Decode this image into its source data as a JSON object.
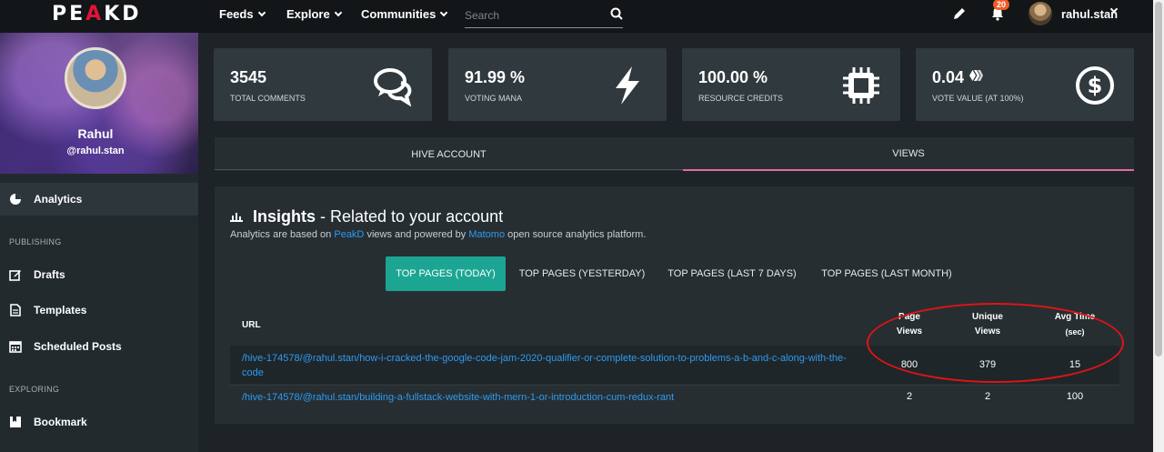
{
  "brand": {
    "logo_text_left": "PE",
    "logo_text_mid": "A",
    "logo_text_right": "KD"
  },
  "nav": {
    "feeds": "Feeds",
    "explore": "Explore",
    "communities": "Communities",
    "search_placeholder": "Search",
    "notifications_count": "20",
    "username": "rahul.stan"
  },
  "profile": {
    "name": "Rahul",
    "handle": "@rahul.stan"
  },
  "sidebar": {
    "analytics": "Analytics",
    "section_publishing": "PUBLISHING",
    "drafts": "Drafts",
    "templates": "Templates",
    "scheduled": "Scheduled Posts",
    "section_exploring": "EXPLORING",
    "bookmark": "Bookmark"
  },
  "stats": [
    {
      "value": "3545",
      "label": "TOTAL COMMENTS",
      "icon": "comments-icon"
    },
    {
      "value": "91.99 %",
      "label": "VOTING MANA",
      "icon": "lightning-icon"
    },
    {
      "value": "100.00 %",
      "label": "RESOURCE CREDITS",
      "icon": "chip-icon"
    },
    {
      "value": "0.04",
      "label": "VOTE VALUE (AT 100%)",
      "icon": "dollar-coin-icon"
    }
  ],
  "tabs": {
    "hive_account": "HIVE ACCOUNT",
    "views": "VIEWS"
  },
  "insights": {
    "title_bold": "Insights",
    "title_rest": " - Related to your account",
    "desc_1": "Analytics are based on ",
    "desc_link1": "PeakD",
    "desc_2": " views and powered by ",
    "desc_link2": "Matomo",
    "desc_3": " open source analytics platform.",
    "subtabs": [
      "TOP PAGES (TODAY)",
      "TOP PAGES (YESTERDAY)",
      "TOP PAGES (LAST 7 DAYS)",
      "TOP PAGES (LAST MONTH)"
    ],
    "columns": {
      "url": "URL",
      "page_views_1": "Page",
      "page_views_2": "Views",
      "unique_1": "Unique",
      "unique_2": "Views",
      "avg_1": "Avg Time",
      "avg_2": "(sec)"
    },
    "rows": [
      {
        "url_line1": "/hive-174578/@rahul.stan/how-i-cracked-the-google-code-jam-2020-qualifier-or-complete-solution-to-problems-a-b-and-c-along-with-the-",
        "url_line2": "code",
        "page_views": "800",
        "unique_views": "379",
        "avg_time": "15"
      },
      {
        "url_line1": "/hive-174578/@rahul.stan/building-a-fullstack-website-with-mern-1-or-introduction-cum-redux-rant",
        "page_views": "2",
        "unique_views": "2",
        "avg_time": "100"
      }
    ]
  },
  "colors": {
    "accent_teal": "#1ca593",
    "link_blue": "#2e9bf0",
    "active_tab_pink": "#e06aa1",
    "annotation_red": "#e01414"
  }
}
